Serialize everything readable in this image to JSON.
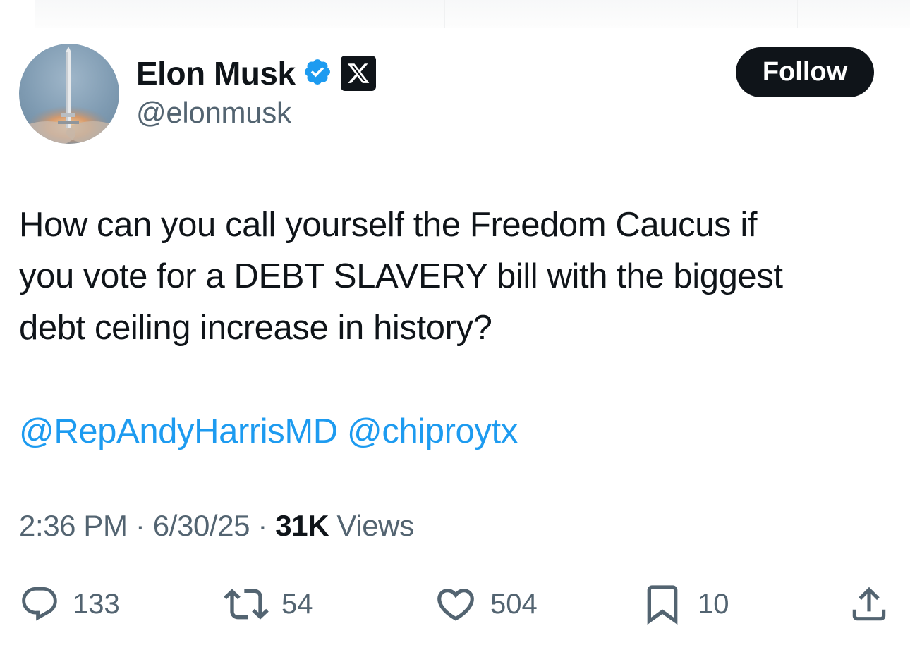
{
  "author": {
    "display_name": "Elon Musk",
    "handle": "@elonmusk",
    "verified_icon": "verified-badge-icon",
    "org_badge_icon": "x-logo-icon"
  },
  "follow_button": {
    "label": "Follow"
  },
  "tweet": {
    "text_lines": [
      "How can you call yourself the Freedom Caucus if",
      "you vote for a DEBT SLAVERY bill with the biggest",
      "debt ceiling increase in history?"
    ],
    "mentions": [
      "@RepAndyHarrisMD",
      "@chiproytx"
    ]
  },
  "meta": {
    "time": "2:36 PM",
    "date": "6/30/25",
    "separator": "·",
    "views_count": "31K",
    "views_label": "Views"
  },
  "actions": {
    "replies": {
      "icon": "reply-icon",
      "count": "133"
    },
    "reposts": {
      "icon": "repost-icon",
      "count": "54"
    },
    "likes": {
      "icon": "heart-icon",
      "count": "504"
    },
    "bookmarks": {
      "icon": "bookmark-icon",
      "count": "10"
    },
    "share": {
      "icon": "share-icon"
    }
  },
  "colors": {
    "text": "#0f1419",
    "secondary": "#536471",
    "link": "#1d9bf0",
    "verified": "#1d9bf0",
    "button_bg": "#0f1419"
  }
}
